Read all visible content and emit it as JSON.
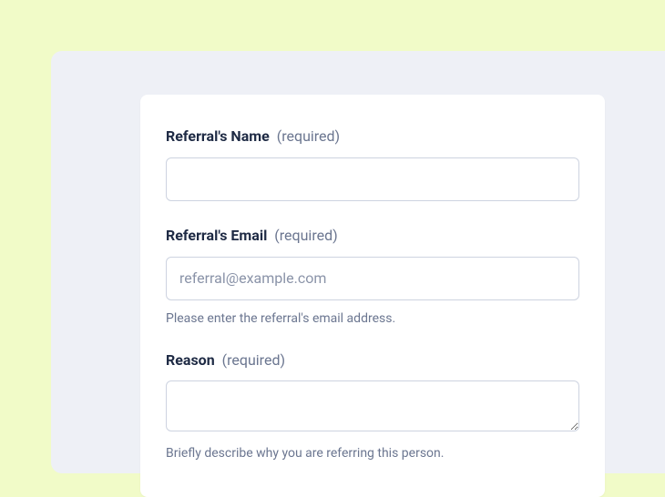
{
  "form": {
    "name": {
      "label": "Referral's Name",
      "required_label": "(required)",
      "value": ""
    },
    "email": {
      "label": "Referral's Email",
      "required_label": "(required)",
      "placeholder": "referral@example.com",
      "help": "Please enter the referral's email address."
    },
    "reason": {
      "label": "Reason",
      "required_label": "(required)",
      "help": "Briefly describe why you are referring this person."
    }
  }
}
